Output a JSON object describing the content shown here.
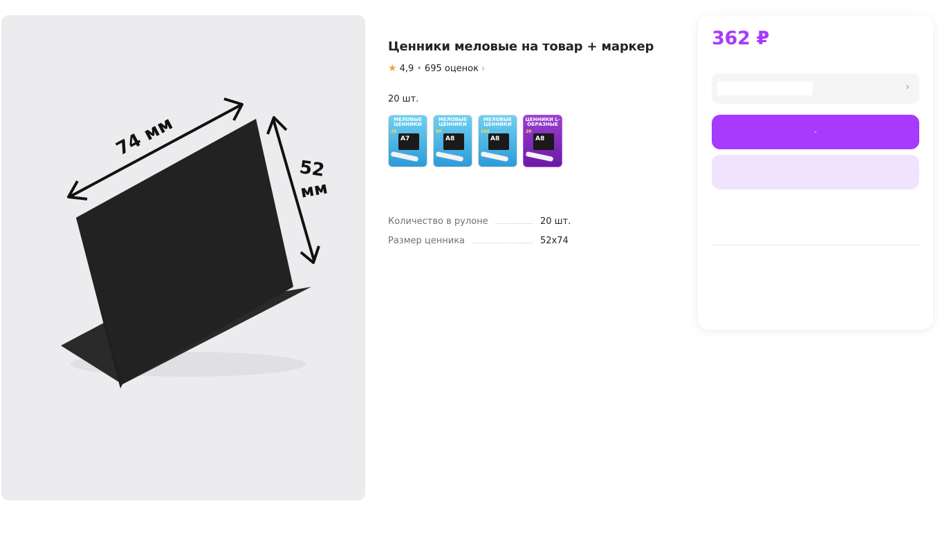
{
  "product": {
    "title": "Ценники меловые на товар + маркер",
    "rating": "4,9",
    "reviews": "695 оценок",
    "variant_label": "20 шт."
  },
  "gallery": {
    "dimension_width": "74 мм",
    "dimension_height_number": "52",
    "dimension_height_unit": "мм"
  },
  "thumbnails": [
    {
      "tag": "МЕЛОВЫЕ ЦЕННИКИ",
      "count": "20",
      "size": "A7",
      "style": "blue"
    },
    {
      "tag": "МЕЛОВЫЕ ЦЕННИКИ",
      "count": "50",
      "size": "A8",
      "style": "blue"
    },
    {
      "tag": "МЕЛОВЫЕ ЦЕННИКИ",
      "count": "100",
      "size": "A8",
      "style": "blue"
    },
    {
      "tag": "ЦЕННИКИ L-ОБРАЗНЫЕ",
      "count": "20",
      "size": "A8",
      "style": "purple"
    }
  ],
  "specs": [
    {
      "label": "Количество в рулоне",
      "value": "20 шт."
    },
    {
      "label": "Размер ценника",
      "value": "52x74"
    }
  ],
  "buybox": {
    "price": "362 ₽",
    "primary_button_label": "-",
    "accent_color": "#a73afd"
  },
  "icons": {
    "star": "star-icon",
    "chevron": "chevron-right-icon"
  }
}
